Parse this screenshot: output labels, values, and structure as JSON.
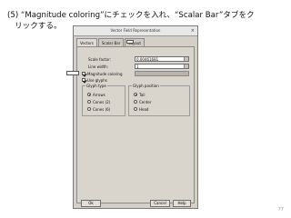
{
  "instruction": {
    "line1": "(5) “Magnitude coloring”にチェックを入れ、“Scalar Bar”タブをク",
    "line2": "リックする。"
  },
  "dialog": {
    "title": "Vector Field Representation",
    "tabs": [
      "Vectors",
      "Scalar Bar",
      "Layout"
    ],
    "scale_factor_label": "Scale factor:",
    "scale_factor_value": "0.00461681",
    "line_width_label": "Line width:",
    "line_width_value": "1",
    "magnitude_coloring_label": "Magnitude coloring",
    "use_glyphs_label": "Use glyphs",
    "glyph_type_title": "Glyph type",
    "glyph_types": [
      "Arrows",
      "Cones (2)",
      "Cones (6)"
    ],
    "glyph_position_title": "Glyph position",
    "glyph_positions": [
      "Tail",
      "Center",
      "Head"
    ],
    "ok_label": "Ok",
    "cancel_label": "Cancel",
    "help_label": "Help"
  },
  "page_number": "77"
}
